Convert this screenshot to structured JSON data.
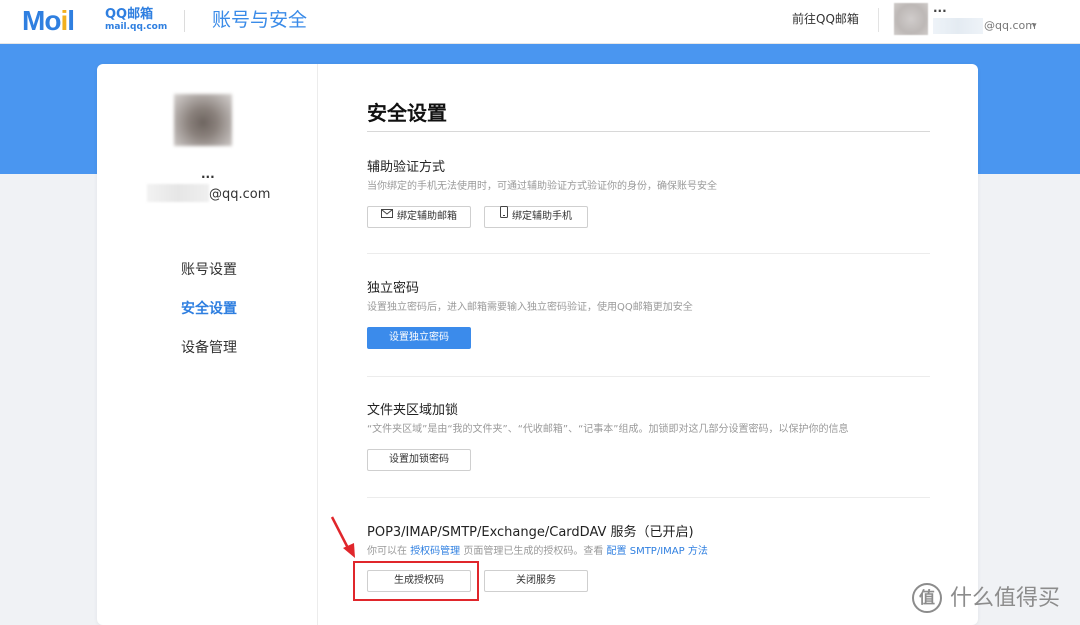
{
  "header": {
    "logo_mail": "Mail",
    "logo_brand": "QQ邮箱",
    "logo_domain": "mail.qq.com",
    "title": "账号与安全",
    "goto_mail": "前往QQ邮箱",
    "nickname": "...",
    "email_suffix": "@qq.com",
    "caret": "▾"
  },
  "sidebar": {
    "nickname": "...",
    "email_suffix": "@qq.com",
    "items": [
      {
        "label": "账号设置"
      },
      {
        "label": "安全设置"
      },
      {
        "label": "设备管理"
      }
    ],
    "active_index": 1
  },
  "main": {
    "title": "安全设置",
    "sections": [
      {
        "title": "辅助验证方式",
        "desc": "当你绑定的手机无法使用时，可通过辅助验证方式验证你的身份，确保账号安全",
        "buttons": [
          {
            "label": "绑定辅助邮箱",
            "icon": "mail-icon"
          },
          {
            "label": "绑定辅助手机",
            "icon": "phone-icon"
          }
        ]
      },
      {
        "title": "独立密码",
        "desc": "设置独立密码后，进入邮箱需要输入独立密码验证，使用QQ邮箱更加安全",
        "buttons": [
          {
            "label": "设置独立密码"
          }
        ]
      },
      {
        "title": "文件夹区域加锁",
        "desc": "“文件夹区域”是由“我的文件夹”、“代收邮箱”、“记事本”组成。加锁即对这几部分设置密码，以保护你的信息",
        "buttons": [
          {
            "label": "设置加锁密码"
          }
        ]
      },
      {
        "title": "POP3/IMAP/SMTP/Exchange/CardDAV 服务（已开启)",
        "desc_prefix": "你可以在 ",
        "desc_link1": "授权码管理",
        "desc_middle": " 页面管理已生成的授权码。查看 ",
        "desc_link2": "配置 SMTP/IMAP 方法",
        "buttons": [
          {
            "label": "生成授权码"
          },
          {
            "label": "关闭服务"
          }
        ]
      }
    ]
  },
  "watermark": {
    "glyph": "值",
    "text": "什么值得买"
  },
  "colors": {
    "accent": "#2f7fe0",
    "band": "#4a96f0",
    "primary_button": "#3b8beb",
    "highlight": "#e0262b"
  }
}
